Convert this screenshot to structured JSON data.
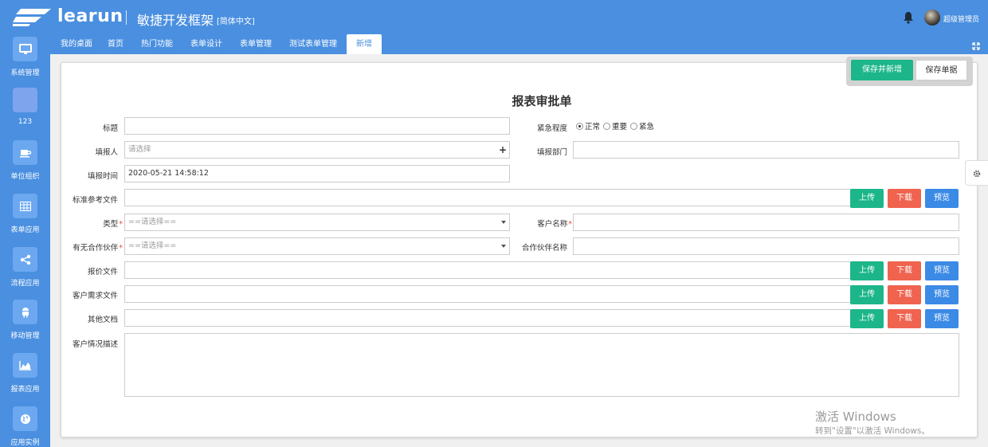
{
  "header": {
    "logo_text": "learun",
    "subtitle": "敏捷开发框架",
    "language": "[简体中文]",
    "username": "超级管理员"
  },
  "sidebar": {
    "items": [
      {
        "label": "系统管理",
        "icon": "monitor-icon"
      },
      {
        "label": "123",
        "icon": "blank-icon"
      },
      {
        "label": "单位组织",
        "icon": "coffee-icon"
      },
      {
        "label": "表单应用",
        "icon": "grid-icon"
      },
      {
        "label": "流程应用",
        "icon": "share-icon"
      },
      {
        "label": "移动管理",
        "icon": "android-icon"
      },
      {
        "label": "报表应用",
        "icon": "area-chart-icon"
      },
      {
        "label": "应用实例",
        "icon": "globe-icon"
      }
    ]
  },
  "tabs": [
    {
      "label": "我的桌面"
    },
    {
      "label": "首页"
    },
    {
      "label": "热门功能"
    },
    {
      "label": "表单设计"
    },
    {
      "label": "表单管理"
    },
    {
      "label": "测试表单管理"
    },
    {
      "label": "新增",
      "active": true
    }
  ],
  "toolbar": {
    "save_new_label": "保存并新增",
    "save_label": "保存单据"
  },
  "form": {
    "title": "报表审批单",
    "fields": {
      "title_label": "标题",
      "title_value": "",
      "urgency_label": "紧急程度",
      "urgency_options": [
        "正常",
        "重要",
        "紧急"
      ],
      "urgency_selected": "正常",
      "reporter_label": "填报人",
      "reporter_placeholder": "请选择",
      "dept_label": "填报部门",
      "dept_value": "",
      "time_label": "填报时间",
      "time_value": "2020-05-21 14:58:12",
      "ref_file_label": "标准参考文件",
      "type_label": "类型",
      "type_placeholder": "==请选择==",
      "customer_label": "客户名称",
      "partner_label": "有无合作伙伴",
      "partner_placeholder": "==请选择==",
      "partner_name_label": "合作伙伴名称",
      "quote_file_label": "报价文件",
      "demand_file_label": "客户需求文件",
      "other_doc_label": "其他文档",
      "desc_label": "客户情况描述",
      "required_mark": "*"
    },
    "buttons": {
      "upload": "上传",
      "download": "下载",
      "preview": "预览"
    }
  },
  "watermark": {
    "line1": "激活 Windows",
    "line2": "转到\"设置\"以激活 Windows。"
  },
  "colors": {
    "brand": "#4a8fe0",
    "green": "#1cb68a",
    "red": "#f0634f",
    "blue": "#3b8ae6"
  }
}
